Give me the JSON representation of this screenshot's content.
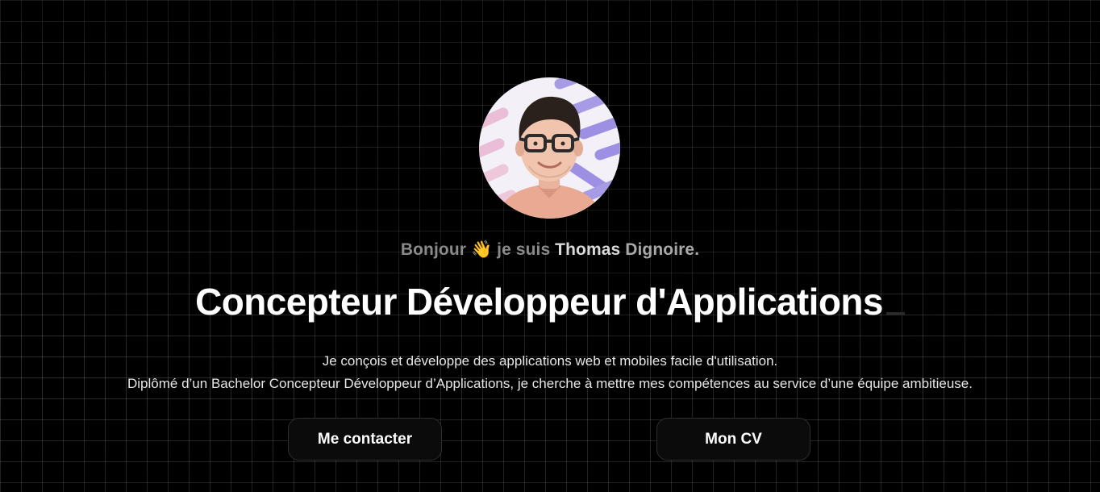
{
  "hero": {
    "avatar_alt": "Thomas Dignoire",
    "greeting": {
      "prefix": "Bonjour",
      "hand_emoji": "👋",
      "middle": "je suis",
      "first_name": "Thomas",
      "last_name": "Dignoire."
    },
    "title": "Concepteur Développeur d'Applications",
    "description_line1": "Je conçois et développe des applications web et mobiles facile d'utilisation.",
    "description_line2": "Diplômé d’un Bachelor Concepteur Développeur d’Applications, je cherche à mettre mes compétences au service d’une équipe ambitieuse."
  },
  "buttons": {
    "contact_label": "Me contacter",
    "cv_label": "Mon CV"
  },
  "colors": {
    "background": "#000000",
    "grid_line": "#3a3a3a",
    "button_bg": "#0b0b0b",
    "button_border": "#2e2e2e"
  },
  "icons": {
    "greeting_icon": "waving-hand-icon"
  }
}
